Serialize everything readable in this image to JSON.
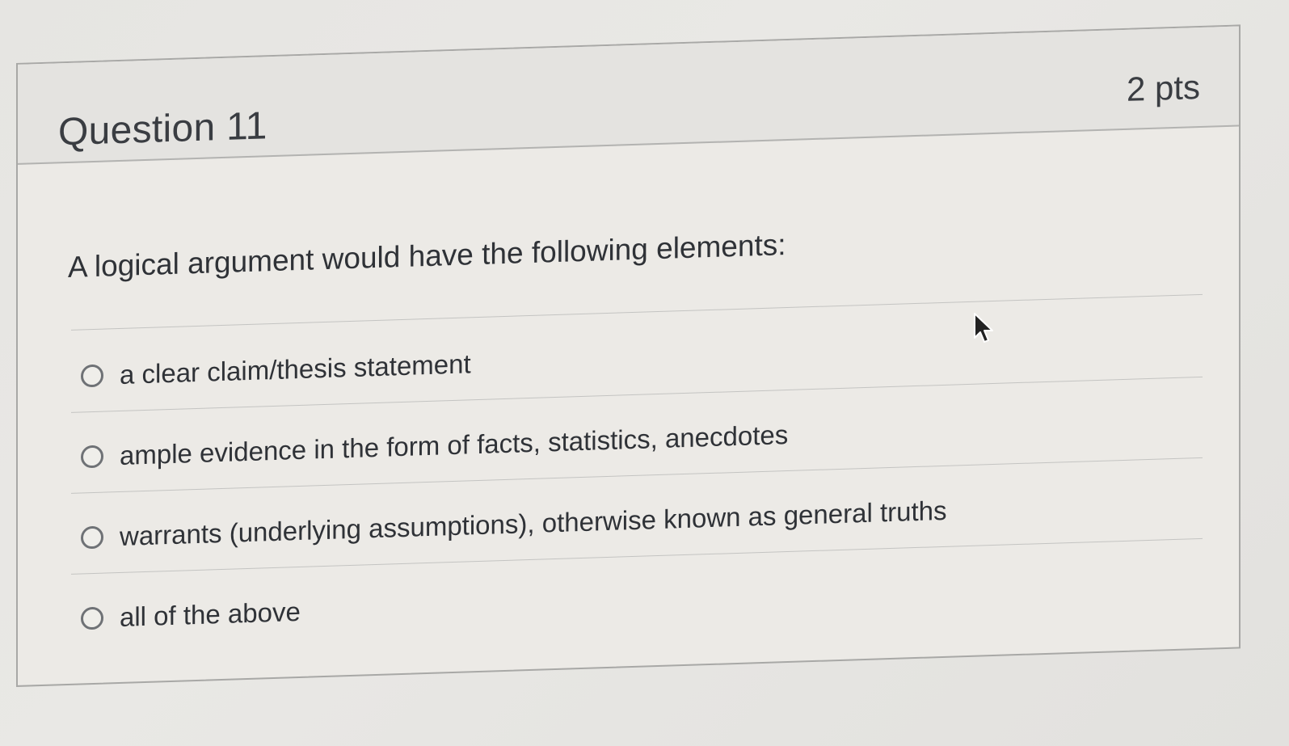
{
  "question": {
    "title": "Question 11",
    "points": "2 pts",
    "prompt": "A logical argument would have the following elements:",
    "answers": [
      {
        "label": "a clear claim/thesis statement",
        "selected": false
      },
      {
        "label": "ample evidence in the form of facts, statistics, anecdotes",
        "selected": false
      },
      {
        "label": "warrants (underlying assumptions), otherwise known as general truths",
        "selected": false
      },
      {
        "label": "all of the above",
        "selected": false
      }
    ]
  },
  "cursor": {
    "icon": "mouse-pointer-icon"
  }
}
